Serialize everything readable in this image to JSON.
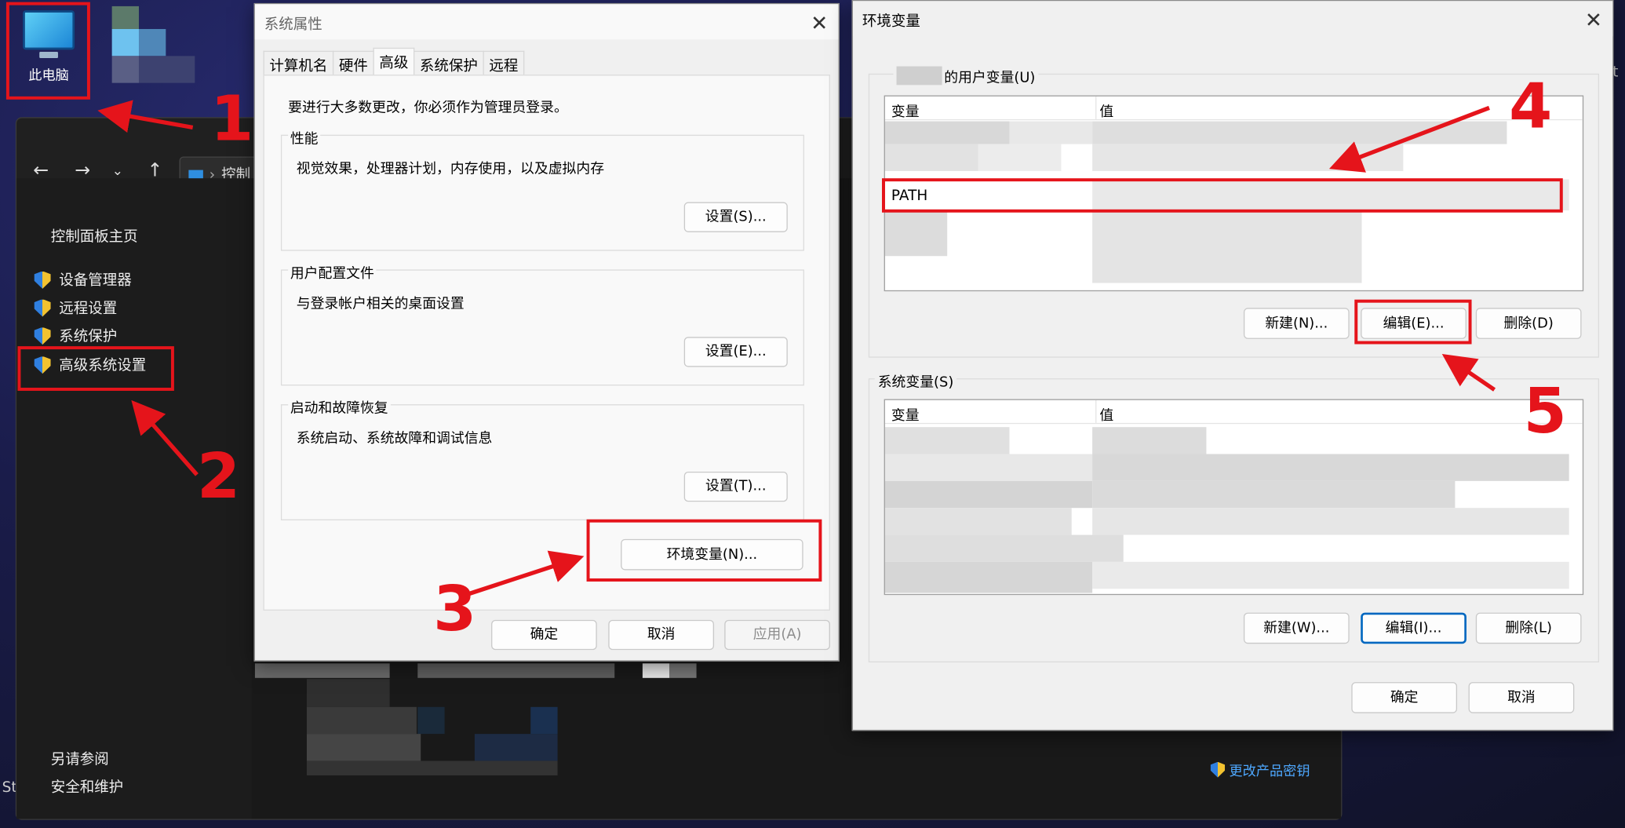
{
  "desktop": {
    "this_pc_label": "此电脑",
    "stray_text_left": "St",
    "stray_text_right": "t"
  },
  "control_panel": {
    "address_text": "控制",
    "sidebar": {
      "home": "控制面板主页",
      "items": [
        "设备管理器",
        "远程设置",
        "系统保护",
        "高级系统设置"
      ],
      "see_also": "另请参阅",
      "security": "安全和维护"
    },
    "product_key_link": "更改产品密钥"
  },
  "system_properties": {
    "title": "系统属性",
    "tabs": [
      "计算机名",
      "硬件",
      "高级",
      "系统保护",
      "远程"
    ],
    "active_tab": "高级",
    "admin_note": "要进行大多数更改，你必须作为管理员登录。",
    "performance": {
      "label": "性能",
      "desc": "视觉效果，处理器计划，内存使用，以及虚拟内存",
      "button": "设置(S)..."
    },
    "user_profiles": {
      "label": "用户配置文件",
      "desc": "与登录帐户相关的桌面设置",
      "button": "设置(E)..."
    },
    "startup_recovery": {
      "label": "启动和故障恢复",
      "desc": "系统启动、系统故障和调试信息",
      "button": "设置(T)..."
    },
    "env_button": "环境变量(N)...",
    "ok": "确定",
    "cancel": "取消",
    "apply": "应用(A)"
  },
  "env_vars": {
    "title": "环境变量",
    "user_vars_label": "的用户变量(U)",
    "col_variable": "变量",
    "col_value": "值",
    "path_row": "PATH",
    "user_buttons": {
      "new": "新建(N)...",
      "edit": "编辑(E)...",
      "delete": "删除(D)"
    },
    "system_vars_label": "系统变量(S)",
    "system_buttons": {
      "new": "新建(W)...",
      "edit": "编辑(I)...",
      "delete": "删除(L)"
    },
    "ok": "确定",
    "cancel": "取消"
  },
  "annotations": [
    "1",
    "2",
    "3",
    "4",
    "5"
  ],
  "colors": {
    "annotation_red": "#e5141b",
    "focus_blue": "#0067c0",
    "link_blue": "#4ea8ff"
  }
}
